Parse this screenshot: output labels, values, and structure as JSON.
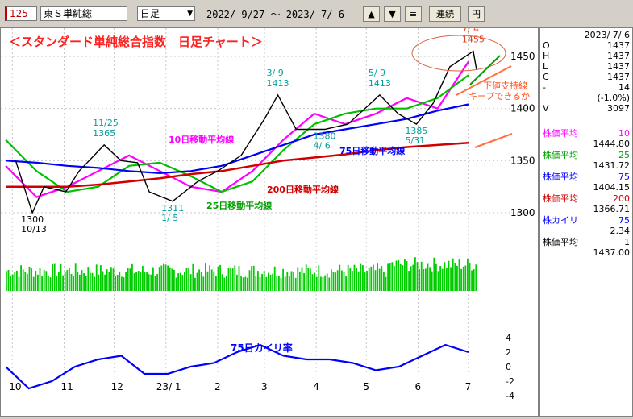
{
  "toolbar": {
    "code": "125",
    "name": "東Ｓ単純総",
    "period": "日足",
    "range": "2022/ 9/27 ～ 2023/ 7/ 6",
    "up": "▲",
    "down": "▼",
    "menu": "≡",
    "renzoku": "連続",
    "yen": "円"
  },
  "colors": {
    "price": "#000000",
    "ma10": "#ff00ff",
    "ma25": "#00c000",
    "ma75": "#0000ff",
    "ma200": "#d00000",
    "volume": "#00cc00",
    "kairi": "#0000ff"
  },
  "sidebar": {
    "date": "2023/ 7/ 6",
    "ohlc": [
      {
        "k": "O",
        "v": "1437"
      },
      {
        "k": "H",
        "v": "1437"
      },
      {
        "k": "L",
        "v": "1437"
      },
      {
        "k": "C",
        "v": "1437"
      },
      {
        "k": "-",
        "v": "14"
      },
      {
        "k": "",
        "v": "(-1.0%)"
      },
      {
        "k": "V",
        "v": "3097"
      }
    ],
    "indicators": [
      {
        "label": "株価平均",
        "param": "10",
        "value": "1444.80",
        "color": "#ff00ff"
      },
      {
        "label": "株価平均",
        "param": "25",
        "value": "1431.72",
        "color": "#00a000"
      },
      {
        "label": "株価平均",
        "param": "75",
        "value": "1404.15",
        "color": "#0000ff"
      },
      {
        "label": "株価平均",
        "param": "200",
        "value": "1366.71",
        "color": "#d00000"
      },
      {
        "label": "株カイリ",
        "param": "75",
        "value": "2.34",
        "color": "#0000ff"
      },
      {
        "label": "株価平均",
        "param": "1",
        "value": "1437.00",
        "color": "#000000"
      }
    ]
  },
  "chart_data": {
    "type": "line",
    "title": "＜スタンダード単純総合指数　日足チャート＞",
    "x_ticks": [
      "10",
      "11",
      "12",
      "23/ 1",
      "2",
      "3",
      "4",
      "5",
      "6",
      "7"
    ],
    "y_ticks": [
      1300,
      1350,
      1400,
      1450
    ],
    "ylim": [
      1280,
      1460
    ],
    "price_points": [
      {
        "x": "2022/10/03",
        "y": 1350
      },
      {
        "x": "2022/10/13",
        "y": 1300
      },
      {
        "x": "2022/10/20",
        "y": 1325
      },
      {
        "x": "2022/11/02",
        "y": 1320
      },
      {
        "x": "2022/11/10",
        "y": 1340
      },
      {
        "x": "2022/11/25",
        "y": 1365
      },
      {
        "x": "2022/12/05",
        "y": 1350
      },
      {
        "x": "2022/12/15",
        "y": 1348
      },
      {
        "x": "2022/12/22",
        "y": 1320
      },
      {
        "x": "2023/01/05",
        "y": 1311
      },
      {
        "x": "2023/01/20",
        "y": 1330
      },
      {
        "x": "2023/02/01",
        "y": 1340
      },
      {
        "x": "2023/02/15",
        "y": 1355
      },
      {
        "x": "2023/03/01",
        "y": 1390
      },
      {
        "x": "2023/03/09",
        "y": 1413
      },
      {
        "x": "2023/03/20",
        "y": 1380
      },
      {
        "x": "2023/04/06",
        "y": 1380
      },
      {
        "x": "2023/04/20",
        "y": 1385
      },
      {
        "x": "2023/05/09",
        "y": 1413
      },
      {
        "x": "2023/05/20",
        "y": 1395
      },
      {
        "x": "2023/05/31",
        "y": 1385
      },
      {
        "x": "2023/06/10",
        "y": 1405
      },
      {
        "x": "2023/06/20",
        "y": 1440
      },
      {
        "x": "2023/07/04",
        "y": 1455
      },
      {
        "x": "2023/07/06",
        "y": 1437
      }
    ],
    "series": [
      {
        "name": "10日移動平均線",
        "values": [
          1345,
          1315,
          1325,
          1340,
          1355,
          1340,
          1325,
          1320,
          1340,
          1370,
          1395,
          1385,
          1395,
          1410,
          1400,
          1445
        ]
      },
      {
        "name": "25日移動平均線",
        "values": [
          1370,
          1340,
          1320,
          1325,
          1345,
          1348,
          1335,
          1320,
          1330,
          1360,
          1385,
          1395,
          1400,
          1400,
          1410,
          1432
        ]
      },
      {
        "name": "75日移動平均線",
        "values": [
          1350,
          1348,
          1345,
          1343,
          1340,
          1338,
          1340,
          1345,
          1355,
          1365,
          1375,
          1380,
          1385,
          1390,
          1398,
          1404
        ]
      },
      {
        "name": "200日移動平均線",
        "values": [
          1325,
          1325,
          1325,
          1327,
          1330,
          1333,
          1337,
          1340,
          1345,
          1350,
          1353,
          1356,
          1360,
          1363,
          1365,
          1367
        ]
      }
    ],
    "annotations": [
      {
        "text": "7/ 4",
        "sub": "1455",
        "date": "2023/07/04",
        "y": 1455
      },
      {
        "text": "3/ 9",
        "sub": "1413",
        "date": "2023/03/09",
        "y": 1413
      },
      {
        "text": "5/ 9",
        "sub": "1413",
        "date": "2023/05/09",
        "y": 1413
      },
      {
        "text": "11/25",
        "sub": "1365",
        "date": "2022/11/25",
        "y": 1365
      },
      {
        "text": "1385",
        "sub": "5/31",
        "date": "2023/05/31",
        "y": 1385
      },
      {
        "text": "1380",
        "sub": "4/ 6",
        "date": "2023/04/06",
        "y": 1380
      },
      {
        "text": "1311",
        "sub": "1/ 5",
        "date": "2023/01/05",
        "y": 1311
      },
      {
        "text": "1300",
        "sub": "10/13",
        "date": "2022/10/13",
        "y": 1300
      }
    ],
    "line_labels": [
      "10日移動平均線",
      "25日移動平均線",
      "75日移動平均線",
      "200日移動平均線"
    ],
    "note_lines": [
      "下値支持線",
      "キープできるか"
    ],
    "kairi": {
      "name": "75日カイリ率",
      "ylim": [
        -4,
        4
      ],
      "ticks": [
        "4",
        "2",
        "0",
        "-2",
        "-4"
      ],
      "values": [
        0,
        -3,
        -2,
        0,
        1,
        1.5,
        -1,
        -1,
        0,
        0.5,
        2,
        3,
        1.5,
        1,
        1,
        0.5,
        -0.5,
        0,
        1.5,
        3,
        2
      ]
    }
  }
}
